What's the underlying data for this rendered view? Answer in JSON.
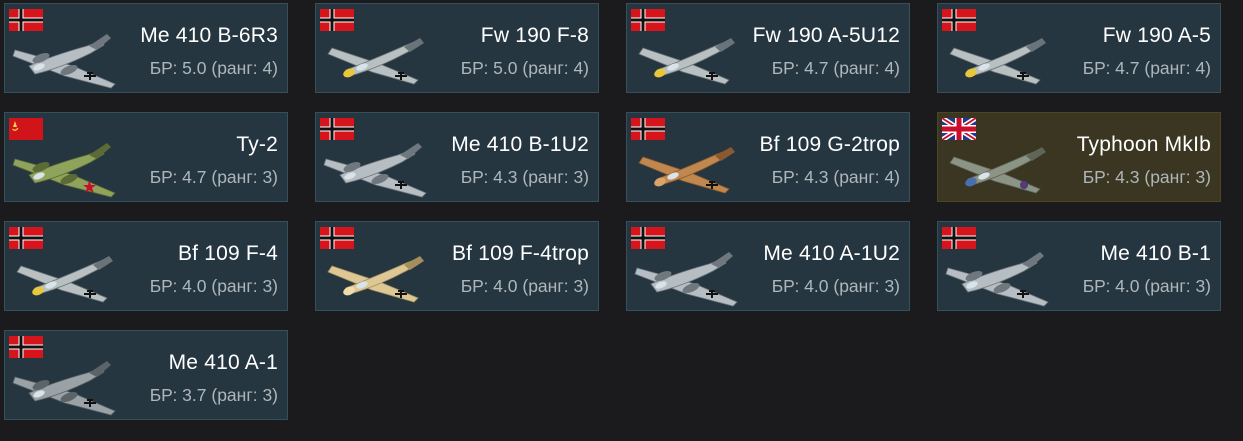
{
  "colors": {
    "background": "#1b1b1d",
    "card": "#263641",
    "card_border": "#33505d",
    "card_premium": "#3a3621",
    "name_text": "#ffffff",
    "br_text": "#aeb6ba"
  },
  "vehicles": [
    {
      "name": "Me 410 B-6R3",
      "br": "БР: 5.0 (ранг: 4)",
      "nation": "germany",
      "flag_icon": "german-flag-icon",
      "plane_icon": "twin-engine-plane-icon",
      "camo": "grey"
    },
    {
      "name": "Fw 190 F-8",
      "br": "БР: 5.0 (ранг: 4)",
      "nation": "germany",
      "flag_icon": "german-flag-icon",
      "plane_icon": "fighter-plane-icon",
      "camo": "grey-yellow"
    },
    {
      "name": "Fw 190 A-5U12",
      "br": "БР: 4.7 (ранг: 4)",
      "nation": "germany",
      "flag_icon": "german-flag-icon",
      "plane_icon": "fighter-plane-icon",
      "camo": "grey-yellow"
    },
    {
      "name": "Fw 190 A-5",
      "br": "БР: 4.7 (ранг: 4)",
      "nation": "germany",
      "flag_icon": "german-flag-icon",
      "plane_icon": "fighter-plane-icon",
      "camo": "grey-yellow"
    },
    {
      "name": "Ту-2",
      "br": "БР: 4.7 (ранг: 3)",
      "nation": "ussr",
      "flag_icon": "soviet-flag-icon",
      "plane_icon": "twin-engine-plane-icon",
      "camo": "green"
    },
    {
      "name": "Me 410 B-1U2",
      "br": "БР: 4.3 (ранг: 3)",
      "nation": "germany",
      "flag_icon": "german-flag-icon",
      "plane_icon": "twin-engine-plane-icon",
      "camo": "grey"
    },
    {
      "name": "Bf 109 G-2trop",
      "br": "БР: 4.3 (ранг: 4)",
      "nation": "germany",
      "flag_icon": "german-flag-icon",
      "plane_icon": "fighter-plane-icon",
      "camo": "desert-brown"
    },
    {
      "name": "Typhoon MkIb",
      "br": "БР: 4.3 (ранг: 3)",
      "nation": "uk",
      "flag_icon": "british-flag-icon",
      "plane_icon": "fighter-plane-icon",
      "camo": "green-grey",
      "premium": true
    },
    {
      "name": "Bf 109 F-4",
      "br": "БР: 4.0 (ранг: 3)",
      "nation": "germany",
      "flag_icon": "german-flag-icon",
      "plane_icon": "fighter-plane-icon",
      "camo": "grey-yellow"
    },
    {
      "name": "Bf 109 F-4trop",
      "br": "БР: 4.0 (ранг: 3)",
      "nation": "germany",
      "flag_icon": "german-flag-icon",
      "plane_icon": "fighter-plane-icon",
      "camo": "desert-tan"
    },
    {
      "name": "Me 410 A-1U2",
      "br": "БР: 4.0 (ранг: 3)",
      "nation": "germany",
      "flag_icon": "german-flag-icon",
      "plane_icon": "twin-engine-plane-icon",
      "camo": "grey"
    },
    {
      "name": "Me 410 B-1",
      "br": "БР: 4.0 (ранг: 3)",
      "nation": "germany",
      "flag_icon": "german-flag-icon",
      "plane_icon": "twin-engine-plane-icon",
      "camo": "grey"
    },
    {
      "name": "Me 410 A-1",
      "br": "БР: 3.7 (ранг: 3)",
      "nation": "germany",
      "flag_icon": "german-flag-icon",
      "plane_icon": "twin-engine-plane-icon",
      "camo": "dark-grey"
    }
  ]
}
